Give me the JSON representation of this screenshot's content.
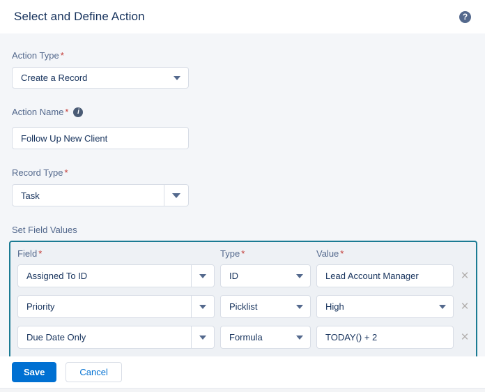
{
  "icons": {
    "question_mark": "?",
    "info": "i",
    "remove": "×"
  },
  "required_marker": "*",
  "header": {
    "title": "Select and Define Action"
  },
  "form": {
    "action_type": {
      "label": "Action Type",
      "value": "Create a Record"
    },
    "action_name": {
      "label": "Action Name",
      "value": "Follow Up New Client"
    },
    "record_type": {
      "label": "Record Type",
      "value": "Task"
    },
    "set_field_values": {
      "heading": "Set Field Values",
      "columns": {
        "field": "Field",
        "type": "Type",
        "value": "Value"
      },
      "rows": [
        {
          "field": "Assigned To ID",
          "type": "ID",
          "value": "Lead Account Manager"
        },
        {
          "field": "Priority",
          "type": "Picklist",
          "value": "High"
        },
        {
          "field": "Due Date Only",
          "type": "Formula",
          "value": "TODAY() + 2"
        },
        {
          "field": "",
          "type": "",
          "value": ""
        }
      ]
    }
  },
  "footer": {
    "save": "Save",
    "cancel": "Cancel"
  },
  "colors": {
    "accent": "#0070d2",
    "panel_border": "#1b7b93",
    "required": "#c23934"
  }
}
